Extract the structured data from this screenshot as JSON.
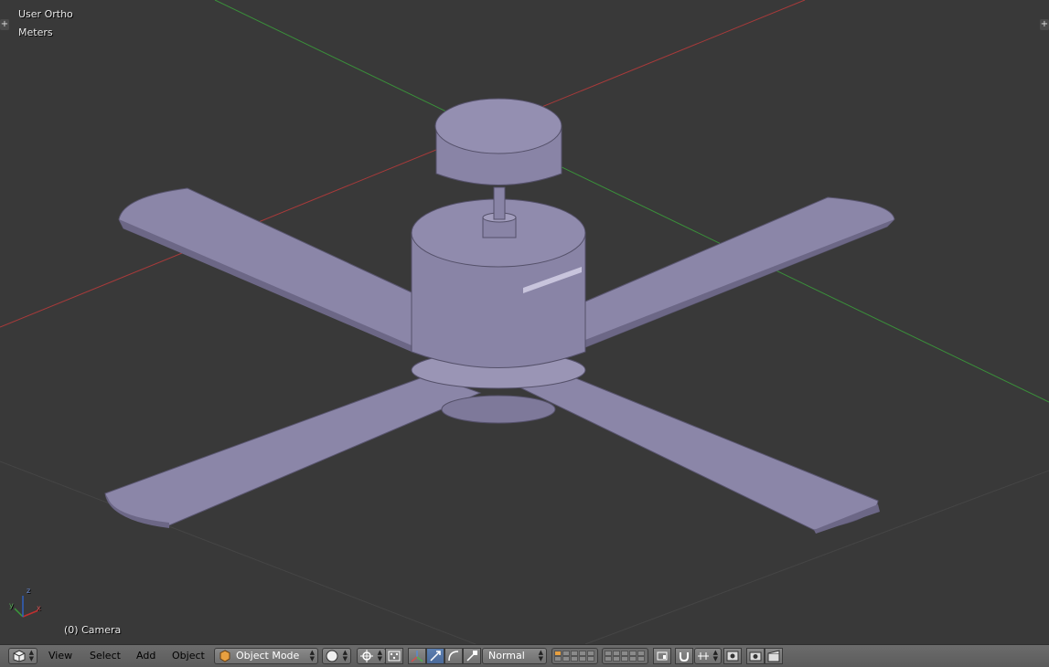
{
  "viewport": {
    "view_label": "User Ortho",
    "units_label": "Meters",
    "object_label": "(0) Camera",
    "axis_labels": {
      "x": "x",
      "y": "y",
      "z": "z"
    },
    "colors": {
      "background": "#393939",
      "x_axis": "#b03030",
      "y_axis": "#3a9a3a",
      "mesh": "#8a84a8",
      "grid": "#4a4a4a"
    }
  },
  "header": {
    "editor_type_icon": "cube-icon",
    "menus": [
      "View",
      "Select",
      "Add",
      "Object"
    ],
    "mode": "Object Mode",
    "shading_icon": "sphere-icon",
    "pivot_icon": "pivot-icon",
    "manipulator_icons": [
      "manipulator-toggle-icon",
      "translate-icon",
      "rotate-icon",
      "scale-icon"
    ],
    "orientation": "Normal",
    "layer_icons": [
      "layers-grid-icon",
      "layers-grid-icon"
    ],
    "right_icons": [
      "lock-camera-icon",
      "snap-magnet-icon",
      "snap-element-icon",
      "render-preview-icon",
      "render-image-icon",
      "render-animation-icon"
    ]
  }
}
